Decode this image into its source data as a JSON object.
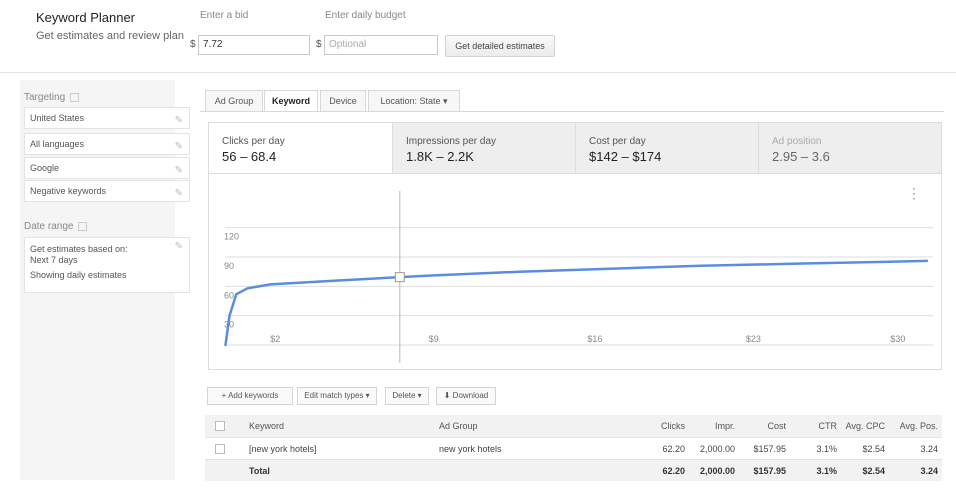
{
  "header": {
    "title": "Keyword Planner",
    "subtitle": "Get estimates and review plan",
    "bid": {
      "label": "Enter a bid",
      "currency": "$",
      "value": "7.72"
    },
    "budget": {
      "label": "Enter daily budget",
      "currency": "$",
      "placeholder": "Optional"
    },
    "estimates_button": "Get detailed estimates"
  },
  "sidebar": {
    "targeting_label": "Targeting",
    "help_glyph": "?",
    "targeting_items": [
      "United States",
      "All languages",
      "Google",
      "Negative keywords"
    ],
    "date_range_label": "Date range",
    "date_lines": [
      "Get estimates based on:",
      "Next 7 days",
      "Showing daily estimates"
    ]
  },
  "tabs": [
    "Ad Group",
    "Keyword",
    "Device",
    "Location: State ▾"
  ],
  "active_tab": "Keyword",
  "metrics": [
    {
      "label": "Clicks per day",
      "value": "56 – 68.4"
    },
    {
      "label": "Impressions per day",
      "value": "1.8K – 2.2K"
    },
    {
      "label": "Cost per day",
      "value": "$142 – $174"
    },
    {
      "label": "Ad position",
      "value": "2.95 – 3.6"
    }
  ],
  "chart_menu_glyph": "⋮",
  "chart_data": {
    "type": "line",
    "series": [
      {
        "values": [
          {
            "x": 0.02,
            "y": 0
          },
          {
            "x": 0.2,
            "y": 30
          },
          {
            "x": 0.5,
            "y": 52
          },
          {
            "x": 1,
            "y": 58
          },
          {
            "x": 2,
            "y": 62
          },
          {
            "x": 5,
            "y": 66
          },
          {
            "x": 9,
            "y": 71
          },
          {
            "x": 13,
            "y": 75
          },
          {
            "x": 17,
            "y": 78
          },
          {
            "x": 21,
            "y": 81
          },
          {
            "x": 25,
            "y": 83
          },
          {
            "x": 31,
            "y": 86
          }
        ]
      }
    ],
    "x_ticks": [
      "$2",
      "$9",
      "$16",
      "$23",
      "$30"
    ],
    "x_tick_values": [
      2,
      9,
      16,
      23,
      30
    ],
    "y_ticks": [
      "30",
      "60",
      "90",
      "120"
    ],
    "y_tick_values": [
      30,
      60,
      90,
      120
    ],
    "xlim": [
      0,
      31
    ],
    "ylim": [
      0,
      135
    ],
    "selected_x": 7.72,
    "line_color": "#5a8ddf",
    "grid": true
  },
  "toolbar": {
    "add_keywords": "Add keywords",
    "add_glyph": "+",
    "edit_match_types": "Edit match types",
    "delete": "Delete",
    "caret": "▾",
    "download": "Download",
    "download_glyph": "⬇"
  },
  "table": {
    "headers": [
      "Keyword",
      "Ad Group",
      "Clicks",
      "Impr.",
      "Cost",
      "CTR",
      "Avg. CPC",
      "Avg. Pos."
    ],
    "rows": [
      [
        "[new york hotels]",
        "new york hotels",
        "62.20",
        "2,000.00",
        "$157.95",
        "3.1%",
        "$2.54",
        "3.24"
      ]
    ],
    "total": [
      "Total",
      "",
      "62.20",
      "2,000.00",
      "$157.95",
      "3.1%",
      "$2.54",
      "3.24"
    ]
  },
  "colors": {
    "accent_line": "#5a8ddf",
    "panel_bg": "#f5f5f5",
    "inactive_tab_bg": "#eeeeee"
  }
}
